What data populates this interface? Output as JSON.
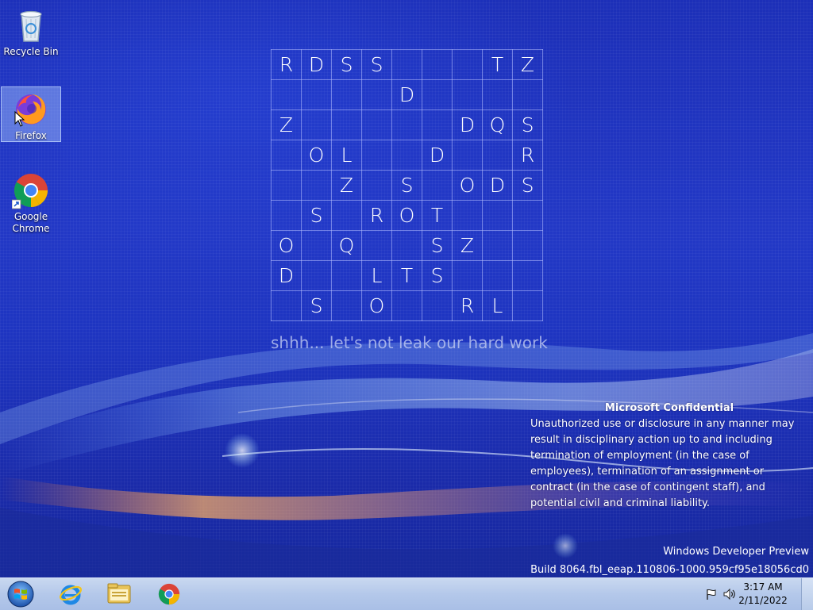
{
  "desktop": {
    "icons": [
      {
        "label": "Recycle Bin",
        "icon": "recycle-bin-icon"
      },
      {
        "label": "Firefox",
        "icon": "firefox-icon"
      },
      {
        "label": "Google Chrome",
        "icon": "chrome-icon"
      }
    ],
    "puzzle": {
      "rows": [
        [
          "R",
          "D",
          "S",
          "S",
          "",
          "",
          "",
          "T",
          "Z"
        ],
        [
          "",
          "",
          "",
          "",
          "D",
          "",
          "",
          "",
          ""
        ],
        [
          "Z",
          "",
          "",
          "",
          "",
          "",
          "D",
          "Q",
          "S"
        ],
        [
          "",
          "O",
          "L",
          "",
          "",
          "D",
          "",
          "",
          "R"
        ],
        [
          "",
          "",
          "Z",
          "",
          "S",
          "",
          "O",
          "D",
          "S"
        ],
        [
          "",
          "S",
          "",
          "R",
          "O",
          "T",
          "",
          "",
          ""
        ],
        [
          "O",
          "",
          "Q",
          "",
          "",
          "S",
          "Z",
          "",
          ""
        ],
        [
          "D",
          "",
          "",
          "L",
          "T",
          "S",
          "",
          "",
          ""
        ],
        [
          "",
          "S",
          "",
          "O",
          "",
          "",
          "R",
          "L",
          ""
        ]
      ],
      "caption": "shhh... let's not leak our hard work"
    },
    "confidential": {
      "title": "Microsoft Confidential",
      "body": "Unauthorized use or disclosure in any manner may result in disciplinary action up to and including termination of employment (in the case of employees), termination of an assignment or contract (in the case of contingent staff), and potential civil and criminal liability."
    },
    "watermark": {
      "line1": "Windows Developer Preview",
      "line2": "Build 8064.fbl_eeap.110806-1000.959cf95e18056cd0"
    }
  },
  "taskbar": {
    "buttons": [
      {
        "icon": "start-orb-icon"
      },
      {
        "icon": "internet-explorer-icon"
      },
      {
        "icon": "file-explorer-icon"
      },
      {
        "icon": "chrome-icon"
      }
    ],
    "tray": {
      "icons": [
        "action-center-flag-icon",
        "volume-icon"
      ],
      "time": "3:17 AM",
      "date": "2/11/2022"
    }
  },
  "colors": {
    "desktop_blue": "#1d34c0",
    "taskbar": "#b4c8ea",
    "text": "#ffffff"
  }
}
